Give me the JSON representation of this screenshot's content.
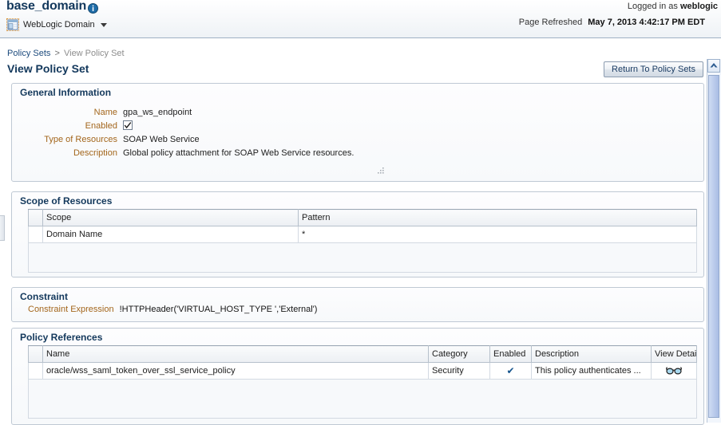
{
  "header": {
    "domain_name": "base_domain",
    "info_icon": "info-icon",
    "context_icon": "weblogic-domain-icon",
    "context_label": "WebLogic Domain",
    "context_caret": "chevron-down-icon",
    "logged_in_prefix": "Logged in as",
    "logged_in_user": "weblogic",
    "page_refreshed_prefix": "Page Refreshed",
    "page_refreshed_time": "May 7, 2013 4:42:17 PM EDT",
    "refresh_icon": "refresh-icon"
  },
  "breadcrumb": {
    "parent": "Policy Sets",
    "separator": ">",
    "current": "View Policy Set"
  },
  "page": {
    "title": "View Policy Set",
    "return_button": "Return To Policy Sets"
  },
  "general_information": {
    "title": "General Information",
    "fields": [
      {
        "label": "Name",
        "value": "gpa_ws_endpoint",
        "type": "text"
      },
      {
        "label": "Enabled",
        "value": "checked",
        "type": "checkbox"
      },
      {
        "label": "Type of Resources",
        "value": "SOAP Web Service",
        "type": "text"
      },
      {
        "label": "Description",
        "value": "Global policy attachment for SOAP Web Service resources.",
        "type": "text"
      }
    ],
    "resize_grip": "resize-grip-icon"
  },
  "scope_of_resources": {
    "title": "Scope of Resources",
    "columns": [
      "Scope",
      "Pattern"
    ],
    "rows": [
      {
        "scope": "Domain Name",
        "pattern": "*"
      }
    ]
  },
  "constraint": {
    "title": "Constraint",
    "label": "Constraint Expression",
    "value": "!HTTPHeader('VIRTUAL_HOST_TYPE ','External')"
  },
  "policy_references": {
    "title": "Policy References",
    "columns": [
      "Name",
      "Category",
      "Enabled",
      "Description",
      "View Detail"
    ],
    "rows": [
      {
        "name": "oracle/wss_saml_token_over_ssl_service_policy",
        "category": "Security",
        "enabled": "✔",
        "description": "This policy authenticates ...",
        "view_detail": "glasses-icon"
      }
    ]
  },
  "colors": {
    "title_navy": "#13385c",
    "label_orange": "#a3661c",
    "link_blue": "#1d4b7d",
    "check_blue": "#14538c",
    "panel_border": "#bfc9d4"
  }
}
